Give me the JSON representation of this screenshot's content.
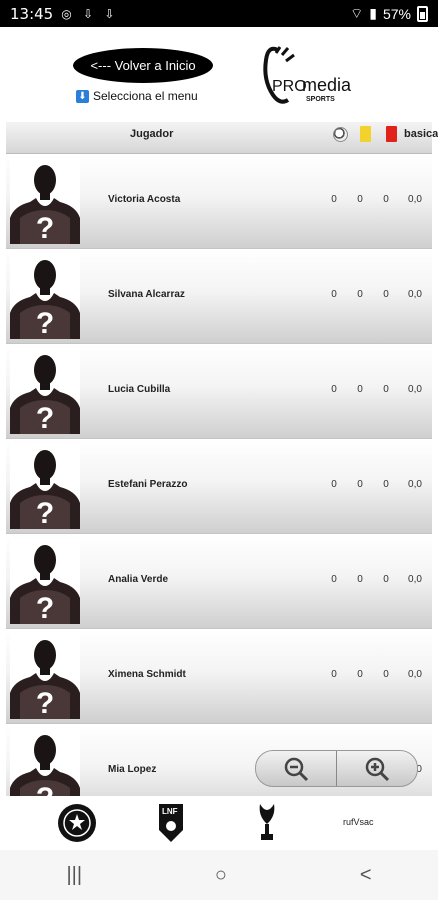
{
  "status": {
    "time": "13:45",
    "battery": "57%",
    "icons": [
      "whatsapp-icon",
      "download-icon",
      "download-icon",
      "wifi-icon",
      "signal-icon"
    ]
  },
  "header": {
    "back_label": "<--- Volver a Inicio",
    "menu_hint": "Selecciona el menu",
    "brand": {
      "pro": "PRO",
      "media": "media",
      "sports": "SPORTS"
    }
  },
  "table": {
    "columns": {
      "player": "Jugador",
      "goals_icon": "ball-icon",
      "yellow_icon": "yellow-card-icon",
      "red_icon": "red-card-icon",
      "basic": "basica"
    },
    "rows": [
      {
        "name": "Victoria Acosta",
        "goals": "0",
        "yellow": "0",
        "red": "0",
        "basic": "0,0"
      },
      {
        "name": "Silvana Alcarraz",
        "goals": "0",
        "yellow": "0",
        "red": "0",
        "basic": "0,0"
      },
      {
        "name": "Lucia Cubilla",
        "goals": "0",
        "yellow": "0",
        "red": "0",
        "basic": "0,0"
      },
      {
        "name": "Estefani Perazzo",
        "goals": "0",
        "yellow": "0",
        "red": "0",
        "basic": "0,0"
      },
      {
        "name": "Analia Verde",
        "goals": "0",
        "yellow": "0",
        "red": "0",
        "basic": "0,0"
      },
      {
        "name": "Ximena Schmidt",
        "goals": "0",
        "yellow": "0",
        "red": "0",
        "basic": "0,0"
      },
      {
        "name": "Mia Lopez",
        "goals": "0",
        "yellow": "0",
        "red": "0",
        "basic": "0,0"
      }
    ]
  },
  "zoom": {
    "out_icon": "zoom-out-icon",
    "in_icon": "zoom-in-icon"
  },
  "footer_logos": [
    "federation-logo",
    "lnf-logo",
    "trophy-logo",
    "sponsor-logo"
  ],
  "nav": {
    "recents": "|||",
    "home": "○",
    "back": "<"
  },
  "colors": {
    "yellow_card": "#f2d22b",
    "red_card": "#e0221b",
    "header_bg": "#000000"
  }
}
